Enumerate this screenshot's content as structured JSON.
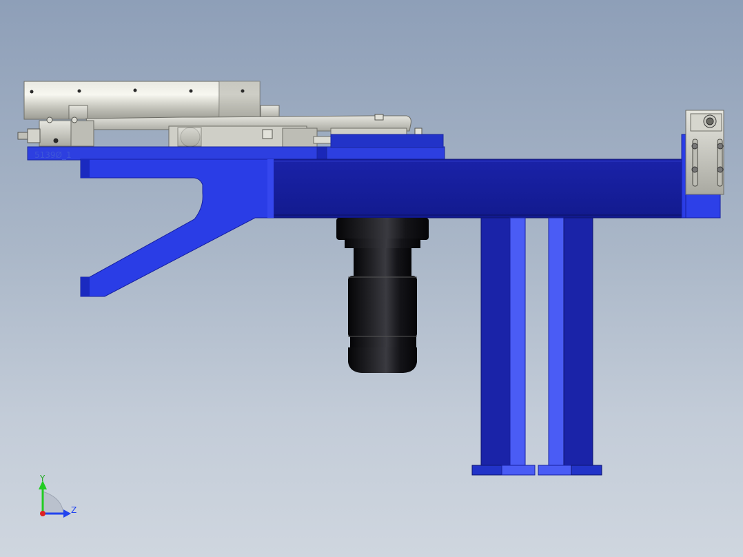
{
  "model": {
    "part_label": "5139Ø_1"
  },
  "triad": {
    "y_label": "Y",
    "z_label": "Z"
  },
  "colors": {
    "background_top": "#8e9fb8",
    "background_bottom": "#cfd6df",
    "frame_blue": "#2233c8",
    "frame_blue_light": "#3d56f0",
    "frame_blue_dark": "#1620a0",
    "metal_silver": "#c9c9c0",
    "motor_black": "#0c0c0e",
    "axis_y": "#22cc22",
    "axis_z": "#2244ee",
    "axis_origin": "#dd2222"
  }
}
